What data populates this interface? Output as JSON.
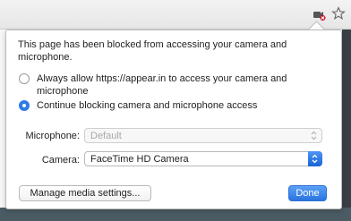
{
  "bubble": {
    "title": "This page has been blocked from accessing your camera and microphone.",
    "options": [
      {
        "label": "Always allow https://appear.in to access your camera and microphone",
        "checked": false
      },
      {
        "label": "Continue blocking camera and microphone access",
        "checked": true
      }
    ],
    "microphone": {
      "label": "Microphone:",
      "value": "Default",
      "disabled": true
    },
    "camera": {
      "label": "Camera:",
      "value": "FaceTime HD Camera"
    },
    "manage_button": "Manage media settings...",
    "done_button": "Done"
  },
  "colors": {
    "accent": "#2f7ae5",
    "blocked": "#d0021b"
  },
  "icons": {
    "toolbar": [
      "camera-blocked-icon",
      "star-icon"
    ]
  }
}
